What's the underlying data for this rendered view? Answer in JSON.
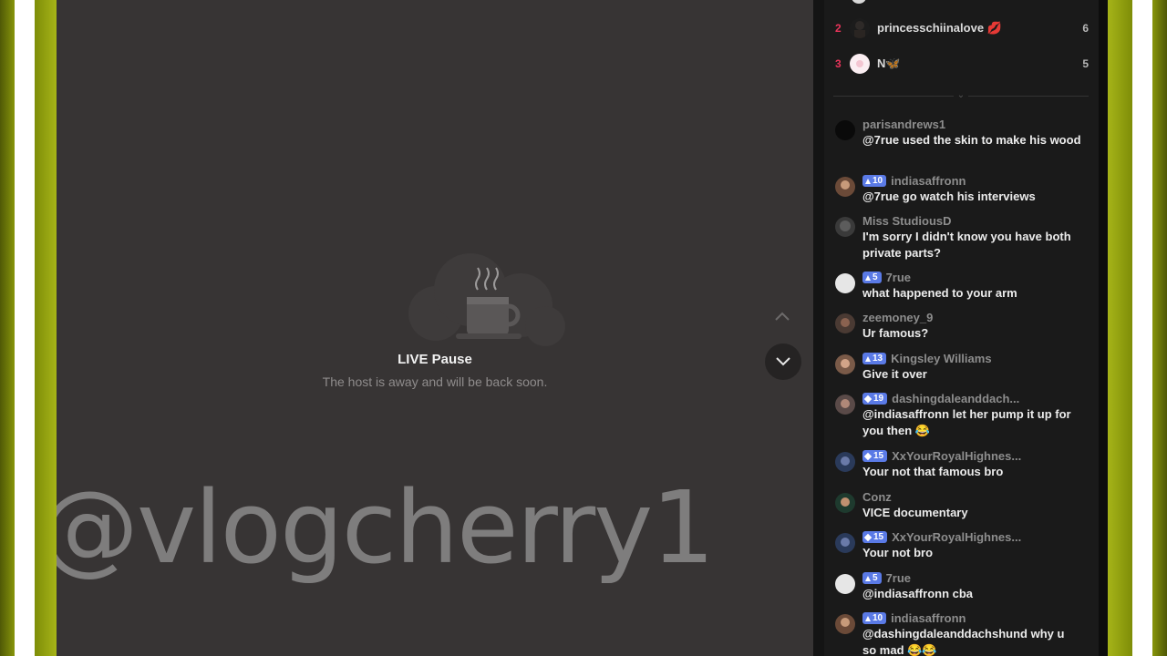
{
  "video": {
    "pause_title": "LIVE Pause",
    "pause_subtitle": "The host is away and will be back soon.",
    "watermark": "@vlogcherry1"
  },
  "leaderboard": [
    {
      "rank": "2",
      "name": "princesschiinalove",
      "emoji": "💋",
      "score": "6"
    },
    {
      "rank": "3",
      "name": "N",
      "emoji": "🦋",
      "score": "5"
    }
  ],
  "chat": [
    {
      "user": "parisandrews1",
      "badge": "",
      "text": "@7rue used the skin to make his wood"
    },
    {
      "user": "indiasaffronn",
      "badge": "10",
      "text": "@7rue go watch his interviews"
    },
    {
      "user": "Miss StudiousD",
      "badge": "",
      "text": "I'm sorry I didn't know you have both private parts?"
    },
    {
      "user": "7rue",
      "badge": "5",
      "text": "what happened to your arm"
    },
    {
      "user": "zeemoney_9",
      "badge": "",
      "text": "Ur famous?"
    },
    {
      "user": "Kingsley Williams",
      "badge": "13",
      "text": "Give it over"
    },
    {
      "user": "dashingdaleanddach...",
      "badge": "19",
      "text": "@indiasaffronn let her pump it up for you then 😂"
    },
    {
      "user": "XxYourRoyalHighnes...",
      "badge": "15",
      "text": "Your not that famous bro"
    },
    {
      "user": "Conz",
      "badge": "",
      "text": "VICE documentary"
    },
    {
      "user": "XxYourRoyalHighnes...",
      "badge": "15",
      "text": "Your not bro"
    },
    {
      "user": "7rue",
      "badge": "5",
      "text": "@indiasaffronn cba"
    },
    {
      "user": "indiasaffronn",
      "badge": "10",
      "text": "@dashingdaleanddachshund why u so mad 😂😂"
    }
  ],
  "colors": {
    "accent": "#e8345a",
    "badge": "#5a7ae6",
    "frame": "#8a9a0a"
  }
}
